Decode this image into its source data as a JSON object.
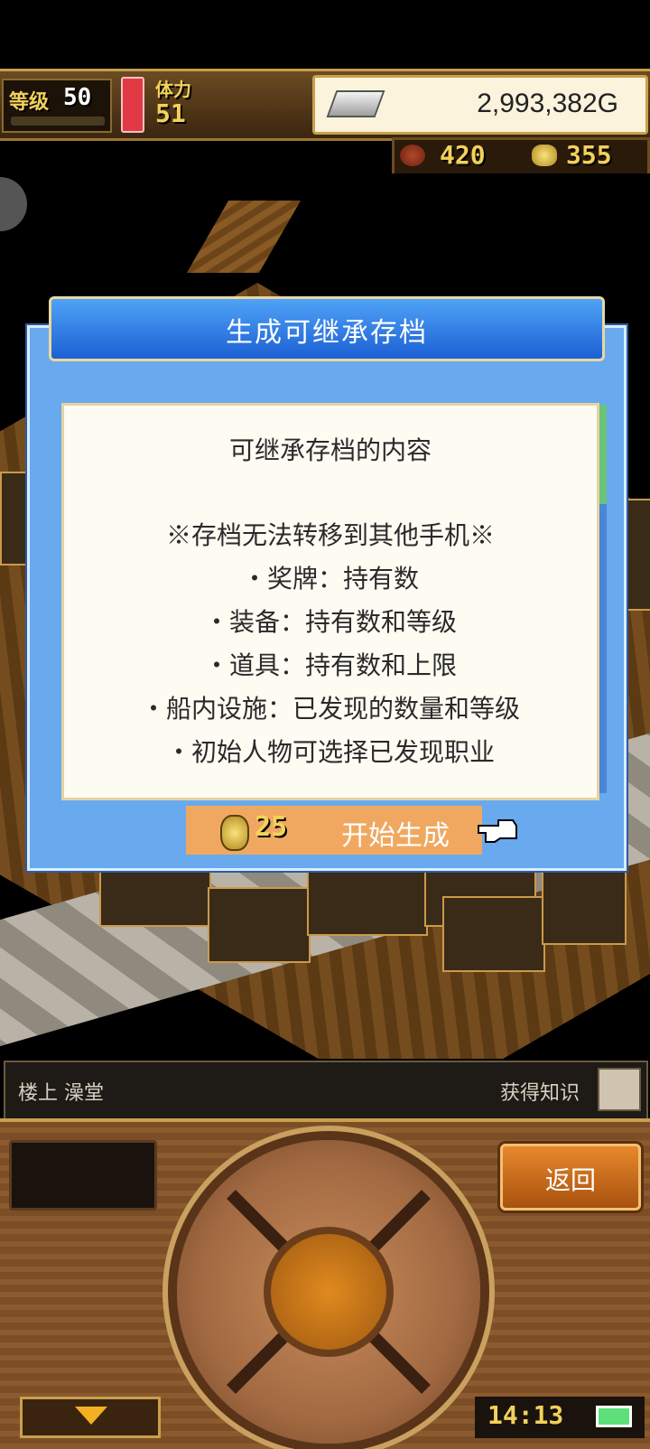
{
  "hud": {
    "level_label": "等级",
    "level_value": "50",
    "stamina_label": "体力",
    "stamina_value": "51",
    "gold": "2,993,382G",
    "meat_count": "420",
    "medal_count": "355"
  },
  "dialog": {
    "title": "生成可继承存档",
    "heading": "可继承存档的内容",
    "notice": "※存档无法转移到其他手机※",
    "items": [
      "・奖牌：持有数",
      "・装备：持有数和等级",
      "・道具：持有数和上限",
      "・船内设施：已发现的数量和等级",
      "・初始人物可选择已发现职业"
    ],
    "start_cost": "25",
    "start_label": "开始生成"
  },
  "info_bar": {
    "location": "楼上 澡堂",
    "knowledge": "获得知识"
  },
  "controller": {
    "back_label": "返回",
    "clock": "14:13"
  },
  "colors": {
    "dialog_bg": "#69a9ee",
    "dialog_header": "#1c5fd4",
    "start_button": "#f0a860",
    "back_button": "#e8882c",
    "gold_text": "#f3d15a"
  },
  "icons": [
    "silver-bar-icon",
    "meat-icon",
    "medal-icon",
    "coin-icon",
    "pointing-hand-icon",
    "fist-icon",
    "battery-icon",
    "down-arrow-icon"
  ]
}
